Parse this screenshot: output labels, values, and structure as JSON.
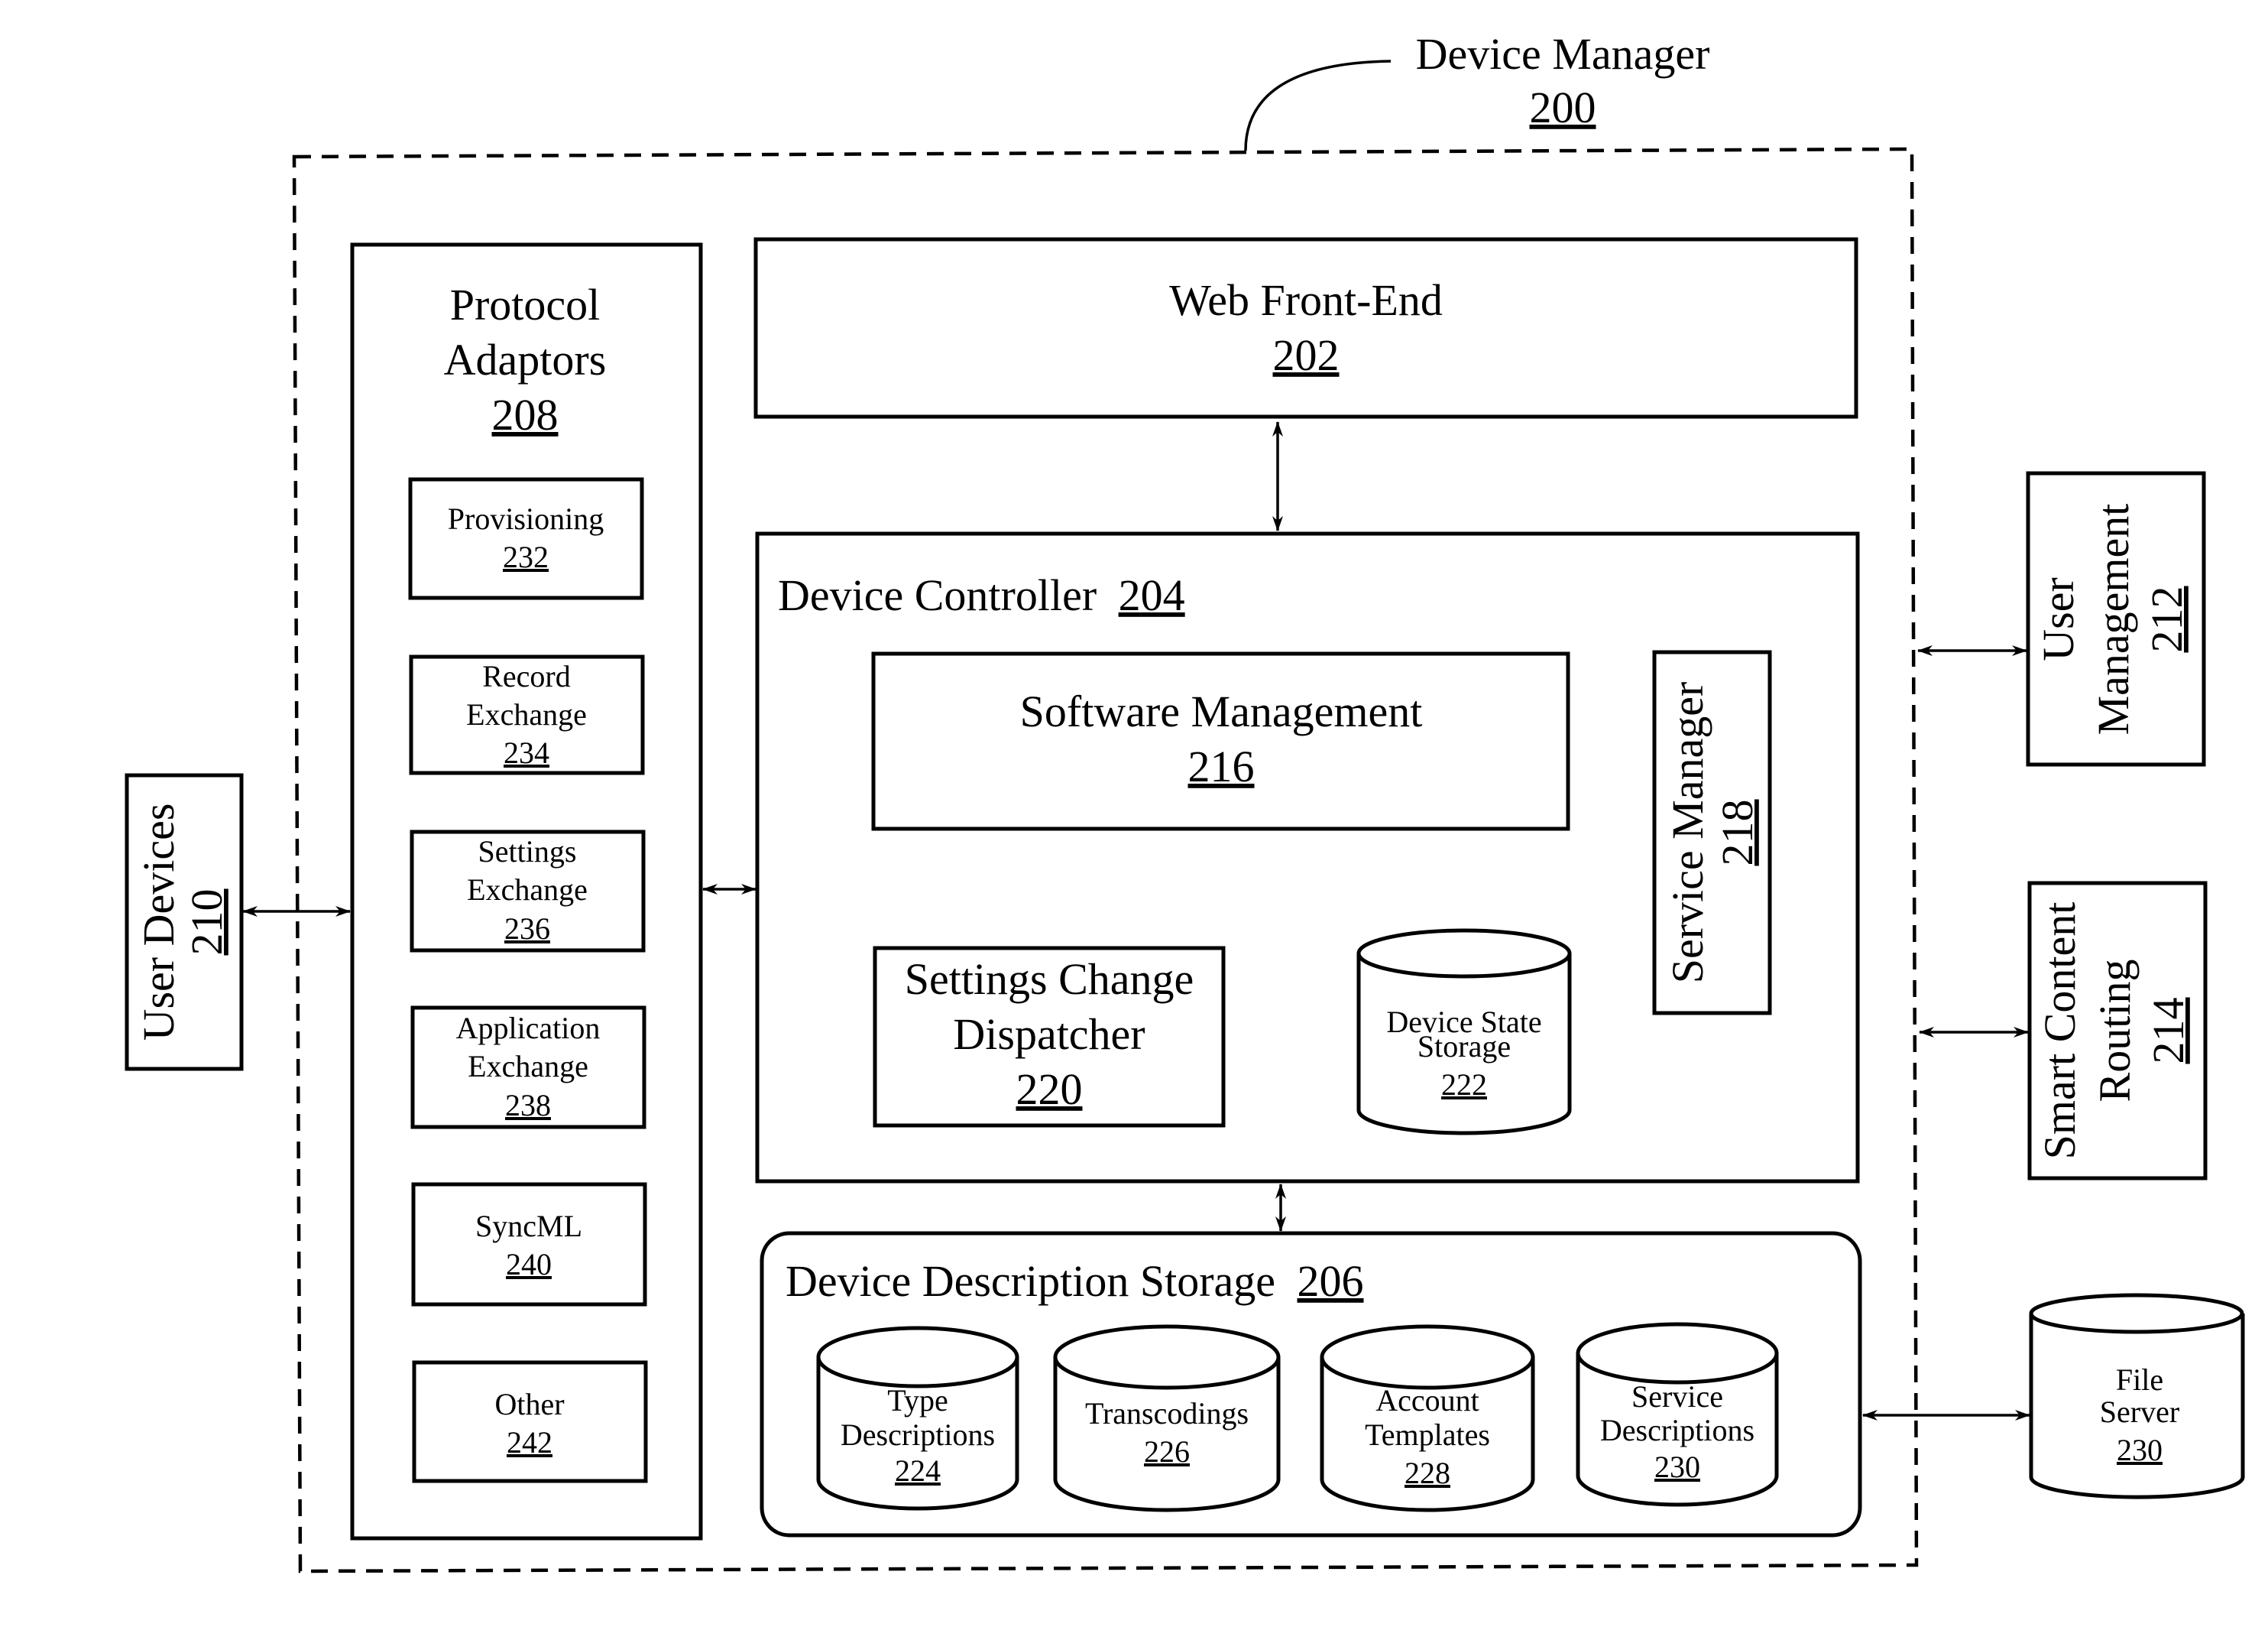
{
  "diagram": {
    "device_manager": {
      "label": "Device Manager",
      "ref": "200"
    },
    "web_front_end": {
      "label": "Web Front-End",
      "ref": "202"
    },
    "device_controller": {
      "label": "Device Controller",
      "ref": "204"
    },
    "software_management": {
      "label": "Software Management",
      "ref": "216"
    },
    "service_manager": {
      "label": "Service Manager",
      "ref": "218"
    },
    "settings_change_dispatcher": {
      "line1": "Settings Change",
      "line2": "Dispatcher",
      "ref": "220"
    },
    "device_state_storage": {
      "line1": "Device State",
      "line2": "Storage",
      "ref": "222"
    },
    "device_description_storage": {
      "label": "Device Description Storage",
      "ref": "206",
      "stores": [
        {
          "line1": "Type",
          "line2": "Descriptions",
          "ref": "224"
        },
        {
          "line1": "Transcodings",
          "line2": "",
          "ref": "226"
        },
        {
          "line1": "Account",
          "line2": "Templates",
          "ref": "228"
        },
        {
          "line1": "Service",
          "line2": "Descriptions",
          "ref": "230"
        }
      ]
    },
    "protocol_adaptors": {
      "line1": "Protocol",
      "line2": "Adaptors",
      "ref": "208",
      "items": [
        {
          "line1": "Provisioning",
          "line2": "",
          "ref": "232"
        },
        {
          "line1": "Record",
          "line2": "Exchange",
          "ref": "234"
        },
        {
          "line1": "Settings",
          "line2": "Exchange",
          "ref": "236"
        },
        {
          "line1": "Application",
          "line2": "Exchange",
          "ref": "238"
        },
        {
          "line1": "SyncML",
          "line2": "",
          "ref": "240"
        },
        {
          "line1": "Other",
          "line2": "",
          "ref": "242"
        }
      ]
    },
    "user_devices": {
      "label": "User Devices",
      "ref": "210"
    },
    "user_management": {
      "line1": "User",
      "line2": "Management",
      "ref": "212"
    },
    "smart_content_routing": {
      "line1": "Smart Content",
      "line2": "Routing",
      "ref": "214"
    },
    "file_server": {
      "line1": "File",
      "line2": "Server",
      "ref": "230"
    }
  }
}
